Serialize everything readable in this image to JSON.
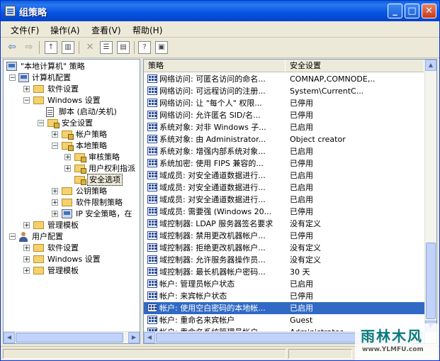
{
  "window": {
    "title": "组策略"
  },
  "menubar": {
    "items": [
      "文件(F)",
      "操作(A)",
      "查看(V)",
      "帮助(H)"
    ]
  },
  "tree": {
    "root": "\"本地计算机\" 策略",
    "computer_config": "计算机配置",
    "software_settings_1": "软件设置",
    "windows_settings_1": "Windows 设置",
    "scripts": "脚本 (启动/关机)",
    "security_settings": "安全设置",
    "account_policies": "帐户策略",
    "local_policies": "本地策略",
    "audit_policy": "审核策略",
    "user_rights": "用户权利指派",
    "security_options": "安全选项",
    "public_key": "公钥策略",
    "software_restriction": "软件限制策略",
    "ip_security": "IP 安全策略，在",
    "admin_templates_1": "管理模板",
    "user_config": "用户配置",
    "software_settings_2": "软件设置",
    "windows_settings_2": "Windows 设置",
    "admin_templates_2": "管理模板"
  },
  "list": {
    "col_policy": "策略",
    "col_setting": "安全设置",
    "rows": [
      {
        "name": "网络访问: 可匿名访问的命名...",
        "value": "COMNAP,COMNODE,..."
      },
      {
        "name": "网络访问: 可远程访问的注册...",
        "value": "System\\CurrentC..."
      },
      {
        "name": "网络访问: 让 \"每个人\" 权限...",
        "value": "已停用"
      },
      {
        "name": "网络访问: 允许匿名 SID/名...",
        "value": "已停用"
      },
      {
        "name": "系统对象: 对非 Windows 子...",
        "value": "已启用"
      },
      {
        "name": "系统对象: 由 Administrator...",
        "value": "Object creator"
      },
      {
        "name": "系统对象: 增强内部系统对象...",
        "value": "已启用"
      },
      {
        "name": "系统加密: 使用 FIPS 兼容的...",
        "value": "已停用"
      },
      {
        "name": "域成员: 对安全通道数据进行...",
        "value": "已启用"
      },
      {
        "name": "域成员: 对安全通道数据进行...",
        "value": "已启用"
      },
      {
        "name": "域成员: 对安全通道数据进行...",
        "value": "已启用"
      },
      {
        "name": "域成员: 需要强 (Windows 20...",
        "value": "已停用"
      },
      {
        "name": "域控制器: LDAP 服务器签名要求",
        "value": "没有定义"
      },
      {
        "name": "域控制器: 禁用更改机器帐户...",
        "value": "已停用"
      },
      {
        "name": "域控制器: 拒绝更改机器帐户...",
        "value": "没有定义"
      },
      {
        "name": "域控制器: 允许服务器操作员...",
        "value": "没有定义"
      },
      {
        "name": "域控制器: 最长机器帐户密码...",
        "value": "30 天"
      },
      {
        "name": "帐户: 管理员帐户状态",
        "value": "已启用"
      },
      {
        "name": "帐户: 来宾帐户状态",
        "value": "已停用"
      },
      {
        "name": "帐户: 使用空白密码的本地帐...",
        "value": "已启用"
      },
      {
        "name": "帐户: 重命名来宾帐户",
        "value": "Guest"
      },
      {
        "name": "帐户: 重命名系统管理员帐户",
        "value": "Administrator"
      }
    ]
  },
  "watermark": {
    "brand": "雨林木风",
    "url": "www.YLMFU.com"
  }
}
